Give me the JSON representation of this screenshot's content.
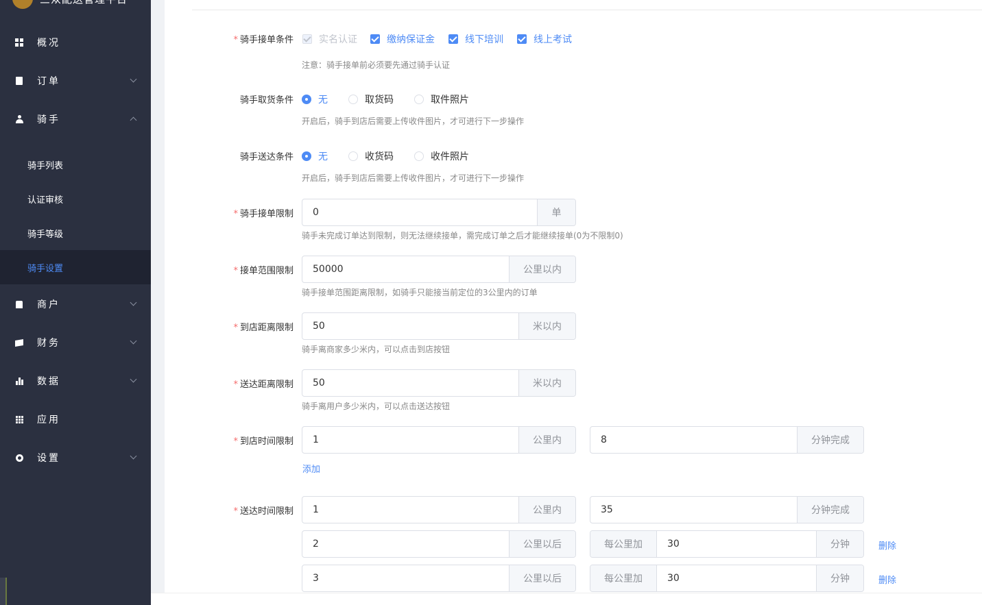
{
  "sidebar": {
    "logo_text": "三众配送管理平台",
    "items": [
      {
        "label": "概况",
        "icon": "dashboard-icon"
      },
      {
        "label": "订单",
        "icon": "clipboard-icon"
      },
      {
        "label": "骑手",
        "icon": "user-icon"
      },
      {
        "label": "商户",
        "icon": "shop-icon"
      },
      {
        "label": "财务",
        "icon": "wallet-icon"
      },
      {
        "label": "数据",
        "icon": "bar-chart-icon"
      },
      {
        "label": "应用",
        "icon": "apps-icon"
      },
      {
        "label": "设置",
        "icon": "gear-icon"
      }
    ],
    "rider_sub": [
      "骑手列表",
      "认证审核",
      "骑手等级",
      "骑手设置"
    ],
    "active_sub": "骑手设置"
  },
  "form": {
    "accept": {
      "label": "骑手接单条件",
      "options": [
        {
          "label": "实名认证",
          "checked": true,
          "disabled": true
        },
        {
          "label": "缴纳保证金",
          "checked": true,
          "disabled": false
        },
        {
          "label": "线下培训",
          "checked": true,
          "disabled": false
        },
        {
          "label": "线上考试",
          "checked": true,
          "disabled": false
        }
      ],
      "hint": "注意：骑手接单前必须要先通过骑手认证"
    },
    "pickup": {
      "label": "骑手取货条件",
      "options": [
        "无",
        "取货码",
        "取件照片"
      ],
      "selected": "无",
      "hint": "开启后，骑手到店后需要上传收件图片，才可进行下一步操作"
    },
    "delivery": {
      "label": "骑手送达条件",
      "options": [
        "无",
        "收货码",
        "收件照片"
      ],
      "selected": "无",
      "hint": "开启后，骑手到店后需要上传收件图片，才可进行下一步操作"
    },
    "order_limit": {
      "label": "骑手接单限制",
      "value": "0",
      "unit": "单",
      "hint": "骑手未完成订单达到限制，则无法继续接单，需完成订单之后才能继续接单(0为不限制0)"
    },
    "range_limit": {
      "label": "接单范围限制",
      "value": "50000",
      "unit": "公里以内",
      "hint": "骑手接单范围距离限制，如骑手只能接当前定位的3公里内的订单"
    },
    "store_distance": {
      "label": "到店距离限制",
      "value": "50",
      "unit": "米以内",
      "hint": "骑手离商家多少米内，可以点击到店按钮"
    },
    "deliver_distance": {
      "label": "送达距离限制",
      "value": "50",
      "unit": "米以内",
      "hint": "骑手离用户多少米内，可以点击送达按钮"
    },
    "store_time": {
      "label": "到店时间限制",
      "km": "1",
      "km_unit": "公里内",
      "minutes": "8",
      "min_unit": "分钟完成",
      "add_label": "添加"
    },
    "deliver_time": {
      "label": "送达时间限制",
      "km": "1",
      "km_unit": "公里内",
      "minutes": "35",
      "min_unit": "分钟完成",
      "extra": [
        {
          "km": "2",
          "km_unit": "公里以后",
          "prefix": "每公里加",
          "minutes": "30",
          "min_unit": "分钟",
          "delete": "删除"
        },
        {
          "km": "3",
          "km_unit": "公里以后",
          "prefix": "每公里加",
          "minutes": "30",
          "min_unit": "分钟",
          "delete": "删除"
        }
      ]
    }
  }
}
